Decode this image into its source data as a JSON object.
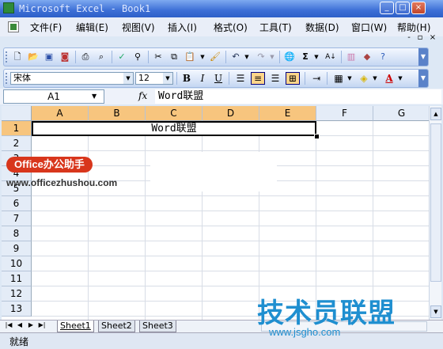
{
  "window": {
    "title": "Microsoft Excel - Book1",
    "controls": [
      "_",
      "□",
      "×"
    ]
  },
  "menu": {
    "items": [
      "文件(F)",
      "编辑(E)",
      "视图(V)",
      "插入(I)",
      "格式(O)",
      "工具(T)",
      "数据(D)",
      "窗口(W)",
      "帮助(H)"
    ],
    "doc_controls": [
      "-",
      "▫",
      "×"
    ]
  },
  "standard_toolbar": {
    "buttons": [
      "new-icon",
      "open-icon",
      "save-icon",
      "permission-icon",
      "print-icon",
      "print-preview-icon",
      "spelling-icon",
      "research-icon",
      "cut-icon",
      "copy-icon",
      "paste-icon",
      "format-painter-icon",
      "undo-icon",
      "redo-icon",
      "hyperlink-icon",
      "autosum-icon",
      "sort-ascending-icon",
      "chart-wizard-icon",
      "help-icon"
    ]
  },
  "format_toolbar": {
    "font_name": "宋体",
    "font_size": "12",
    "bold": "B",
    "italic": "I",
    "underline": "U",
    "font_color": "A"
  },
  "formula_bar": {
    "name_box": "A1",
    "fx": "fx",
    "content": "Word联盟"
  },
  "sheet": {
    "columns": [
      "A",
      "B",
      "C",
      "D",
      "E",
      "F",
      "G"
    ],
    "rows": [
      "1",
      "2",
      "3",
      "4",
      "5",
      "6",
      "7",
      "8",
      "9",
      "10",
      "11",
      "12",
      "13"
    ],
    "merged_cell_text": "Word联盟"
  },
  "tabs": {
    "sheets": [
      "Sheet1",
      "Sheet2",
      "Sheet3"
    ],
    "active": "Sheet1"
  },
  "status": {
    "text": "就绪"
  },
  "watermarks": {
    "badge": "Office办公助手",
    "url": "www.officezhushou.com",
    "brand": "技术员联盟",
    "brand_url": "www.jsgho.com"
  },
  "colors": {
    "title_blue": "#3d6fd6",
    "selected_header": "#f7c57e",
    "badge_red": "#d8361c",
    "brand_blue": "#1f8fd0"
  }
}
